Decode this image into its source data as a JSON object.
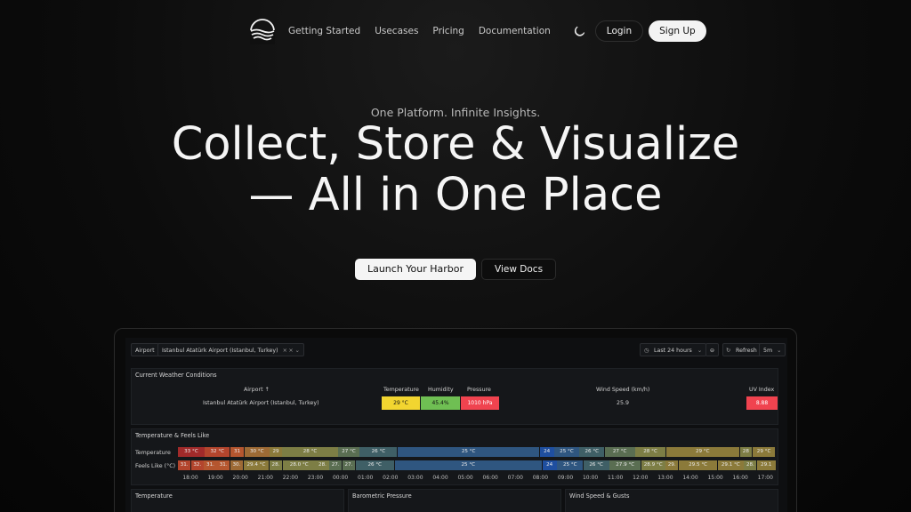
{
  "nav": {
    "links": [
      "Getting Started",
      "Usecases",
      "Pricing",
      "Documentation"
    ],
    "login_label": "Login",
    "signup_label": "Sign Up"
  },
  "hero": {
    "tagline": "One Platform. Infinite Insights.",
    "headline_line1": "Collect, Store & Visualize",
    "headline_line2": "— All in One Place",
    "primary_cta": "Launch Your Harbor",
    "secondary_cta": "View Docs"
  },
  "dashboard": {
    "filter_label": "Airport",
    "filter_value": "Istanbul Atatürk Airport (Istanbul, Turkey)",
    "time_range": "Last 24 hours",
    "refresh_label": "Refresh",
    "refresh_interval": "5m",
    "weather": {
      "title": "Current Weather Conditions",
      "headers": [
        "Airport ↑",
        "Temperature",
        "Humidity",
        "Pressure",
        "Wind Speed (km/h)",
        "UV Index"
      ],
      "row": {
        "airport": "Istanbul Atatürk Airport (Istanbul, Turkey)",
        "temperature": "29 °C",
        "humidity": "45.4%",
        "pressure": "1010 hPa",
        "wind": "25.9",
        "uv": "8.88"
      },
      "colors": {
        "temperature": "#f2d530",
        "humidity": "#6fbf53",
        "pressure": "#f0434f",
        "uv": "#f0434f"
      }
    },
    "state_timeline": {
      "title": "Temperature & Feels Like",
      "rows": [
        {
          "label": "Temperature",
          "segments": [
            {
              "text": "33 °C",
              "color": "#a12a2a"
            },
            {
              "text": "32 °C",
              "color": "#b3452d"
            },
            {
              "text": "31",
              "color": "#b5562f"
            },
            {
              "text": "30 °C",
              "color": "#9d6a35"
            },
            {
              "text": "29",
              "color": "#8b7a3a"
            },
            {
              "text": "28 °C",
              "color": "#7d7e45"
            },
            {
              "text": "27 °C",
              "color": "#5a6e52"
            },
            {
              "text": "26 °C",
              "color": "#3f5f66"
            },
            {
              "text": "25 °C",
              "color": "#2f5680"
            },
            {
              "text": "24",
              "color": "#1f4fa0"
            },
            {
              "text": "25 °C",
              "color": "#2f5680"
            },
            {
              "text": "26 °C",
              "color": "#3f5f66"
            },
            {
              "text": "27 °C",
              "color": "#5a6e52"
            },
            {
              "text": "28 °C",
              "color": "#7d7e45"
            },
            {
              "text": "29 °C",
              "color": "#8b7a3a"
            },
            {
              "text": "28",
              "color": "#7d7e45"
            },
            {
              "text": "29 °C",
              "color": "#8b7a3a"
            }
          ]
        },
        {
          "label": "Feels Like (°C)",
          "segments": [
            {
              "text": "31.",
              "color": "#b3452d"
            },
            {
              "text": "32.",
              "color": "#b3452d"
            },
            {
              "text": "31.",
              "color": "#b5562f"
            },
            {
              "text": "31.",
              "color": "#b5562f"
            },
            {
              "text": "30.",
              "color": "#9d6a35"
            },
            {
              "text": "29.4 °C",
              "color": "#8b7a3a"
            },
            {
              "text": "28.",
              "color": "#7d7e45"
            },
            {
              "text": "28.0 °C",
              "color": "#7d7e45"
            },
            {
              "text": "28.",
              "color": "#7d7e45"
            },
            {
              "text": "27.",
              "color": "#5a6e52"
            },
            {
              "text": "27.",
              "color": "#5a6e52"
            },
            {
              "text": "26 °C",
              "color": "#3f5f66"
            },
            {
              "text": "25 °C",
              "color": "#2f5680"
            },
            {
              "text": "24",
              "color": "#1f4fa0"
            },
            {
              "text": "25 °C",
              "color": "#2f5680"
            },
            {
              "text": "26 °C",
              "color": "#3f5f66"
            },
            {
              "text": "27.9 °C",
              "color": "#5a6e52"
            },
            {
              "text": "28.9 °C",
              "color": "#7d7e45"
            },
            {
              "text": "29.",
              "color": "#8b7a3a"
            },
            {
              "text": "29.5 °C",
              "color": "#8b7a3a"
            },
            {
              "text": "29.1 °C",
              "color": "#8b7a3a"
            },
            {
              "text": "28.",
              "color": "#7d7e45"
            },
            {
              "text": "29.1",
              "color": "#8b7a3a"
            }
          ]
        }
      ],
      "ticks": [
        "18:00",
        "19:00",
        "20:00",
        "21:00",
        "22:00",
        "23:00",
        "00:00",
        "01:00",
        "02:00",
        "03:00",
        "04:00",
        "05:00",
        "06:00",
        "07:00",
        "08:00",
        "09:00",
        "10:00",
        "11:00",
        "12:00",
        "13:00",
        "14:00",
        "15:00",
        "16:00",
        "17:00"
      ]
    },
    "bottom_panels": [
      "Temperature",
      "Barometric Pressure",
      "Wind Speed & Gusts"
    ]
  }
}
